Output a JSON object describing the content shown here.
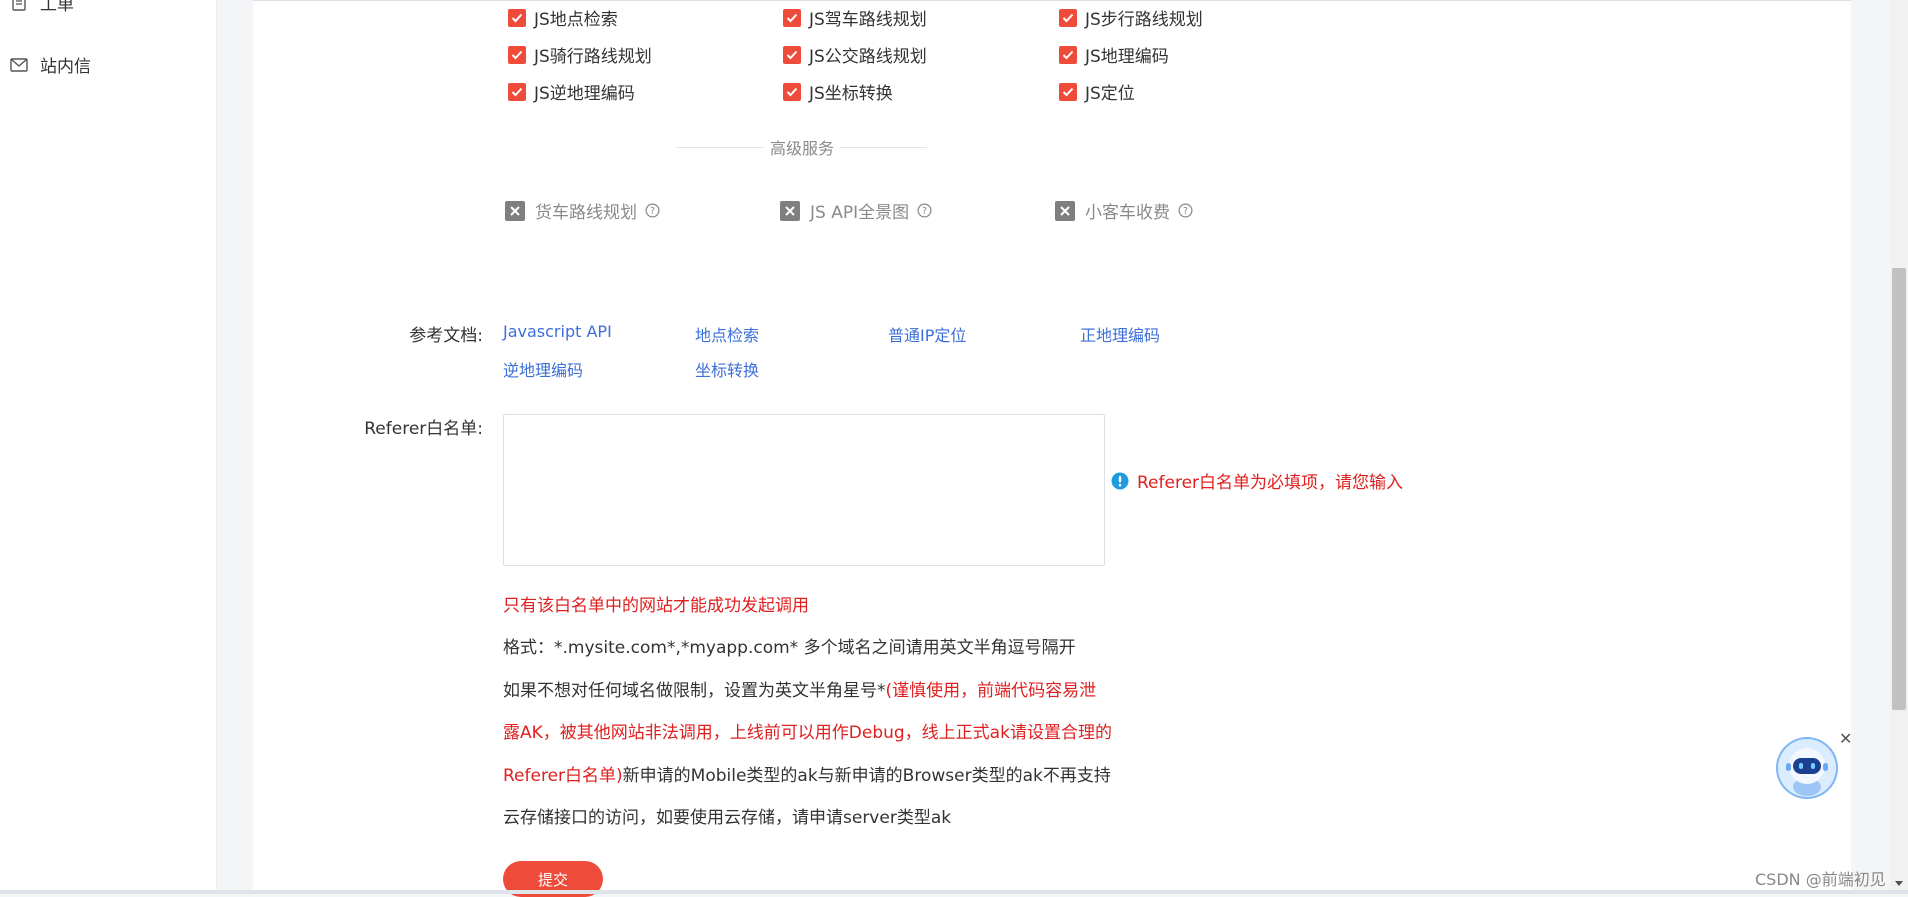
{
  "sidebar": {
    "items": [
      {
        "label": "工单",
        "icon": "document-icon"
      },
      {
        "label": "站内信",
        "icon": "mail-icon"
      }
    ]
  },
  "services": {
    "checked": [
      "JS地点检索",
      "JS驾车路线规划",
      "JS步行路线规划",
      "JS骑行路线规划",
      "JS公交路线规划",
      "JS地理编码",
      "JS逆地理编码",
      "JS坐标转换",
      "JS定位"
    ],
    "advanced_title": "高级服务",
    "advanced": [
      "货车路线规划",
      "JS API全景图",
      "小客车收费"
    ]
  },
  "docs": {
    "label": "参考文档:",
    "links": [
      "Javascript API",
      "地点检索",
      "普通IP定位",
      "正地理编码",
      "逆地理编码",
      "坐标转换"
    ]
  },
  "referer": {
    "label": "Referer白名单:",
    "value": "",
    "error": "Referer白名单为必填项，请您输入"
  },
  "help": {
    "line1": "只有该白名单中的网站才能成功发起调用",
    "line2": "格式：*.mysite.com*,*myapp.com* 多个域名之间请用英文半角逗号隔开",
    "line3_a": "如果不想对任何域名做限制，设置为英文半角星号*",
    "line3_b": "(谨慎使用，前端代码容易泄",
    "line4": "露AK，被其他网站非法调用，上线前可以用作Debug，线上正式ak请设置合理的",
    "line5_a": "Referer白名单)",
    "line5_b": "新申请的Mobile类型的ak与新申请的Browser类型的ak不再支持",
    "line6": "云存储接口的访问，如要使用云存储，请申请server类型ak"
  },
  "submit_label": "提交",
  "watermark": "CSDN @前端初见",
  "colors": {
    "accent": "#ef4b3a",
    "link": "#3d6fd9",
    "error": "#e02020"
  }
}
